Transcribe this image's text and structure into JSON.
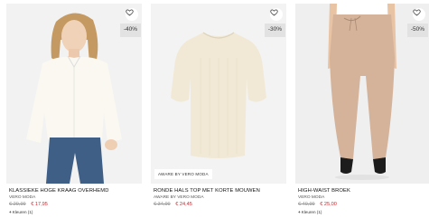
{
  "products": [
    {
      "discount": "-40%",
      "title": "KLASSIEKE HOGE KRAAG OVERHEMD",
      "brand": "VERO MODA",
      "old_price": "€ 29,99",
      "new_price": "€ 17,95",
      "colors": "Kleuren (1)",
      "image_tag": ""
    },
    {
      "discount": "-30%",
      "title": "RONDE HALS TOP MET KORTE MOUWEN",
      "brand": "AWARE BY VERO MODA",
      "old_price": "€ 34,99",
      "new_price": "€ 24,45",
      "colors": "",
      "image_tag": "AWARE BY VERO MODA"
    },
    {
      "discount": "-50%",
      "title": "HIGH-WAIST BROEK",
      "brand": "VERO MODA",
      "old_price": "€ 49,99",
      "new_price": "€ 25,00",
      "colors": "Kleuren (1)",
      "image_tag": ""
    }
  ],
  "icons": {
    "wishlist": "heart-outline-icon",
    "colors": "plus-icon"
  },
  "colors": {
    "sale_price": "#d0262d",
    "old_price": "#999999",
    "badge_bg": "#e2e2e2"
  }
}
